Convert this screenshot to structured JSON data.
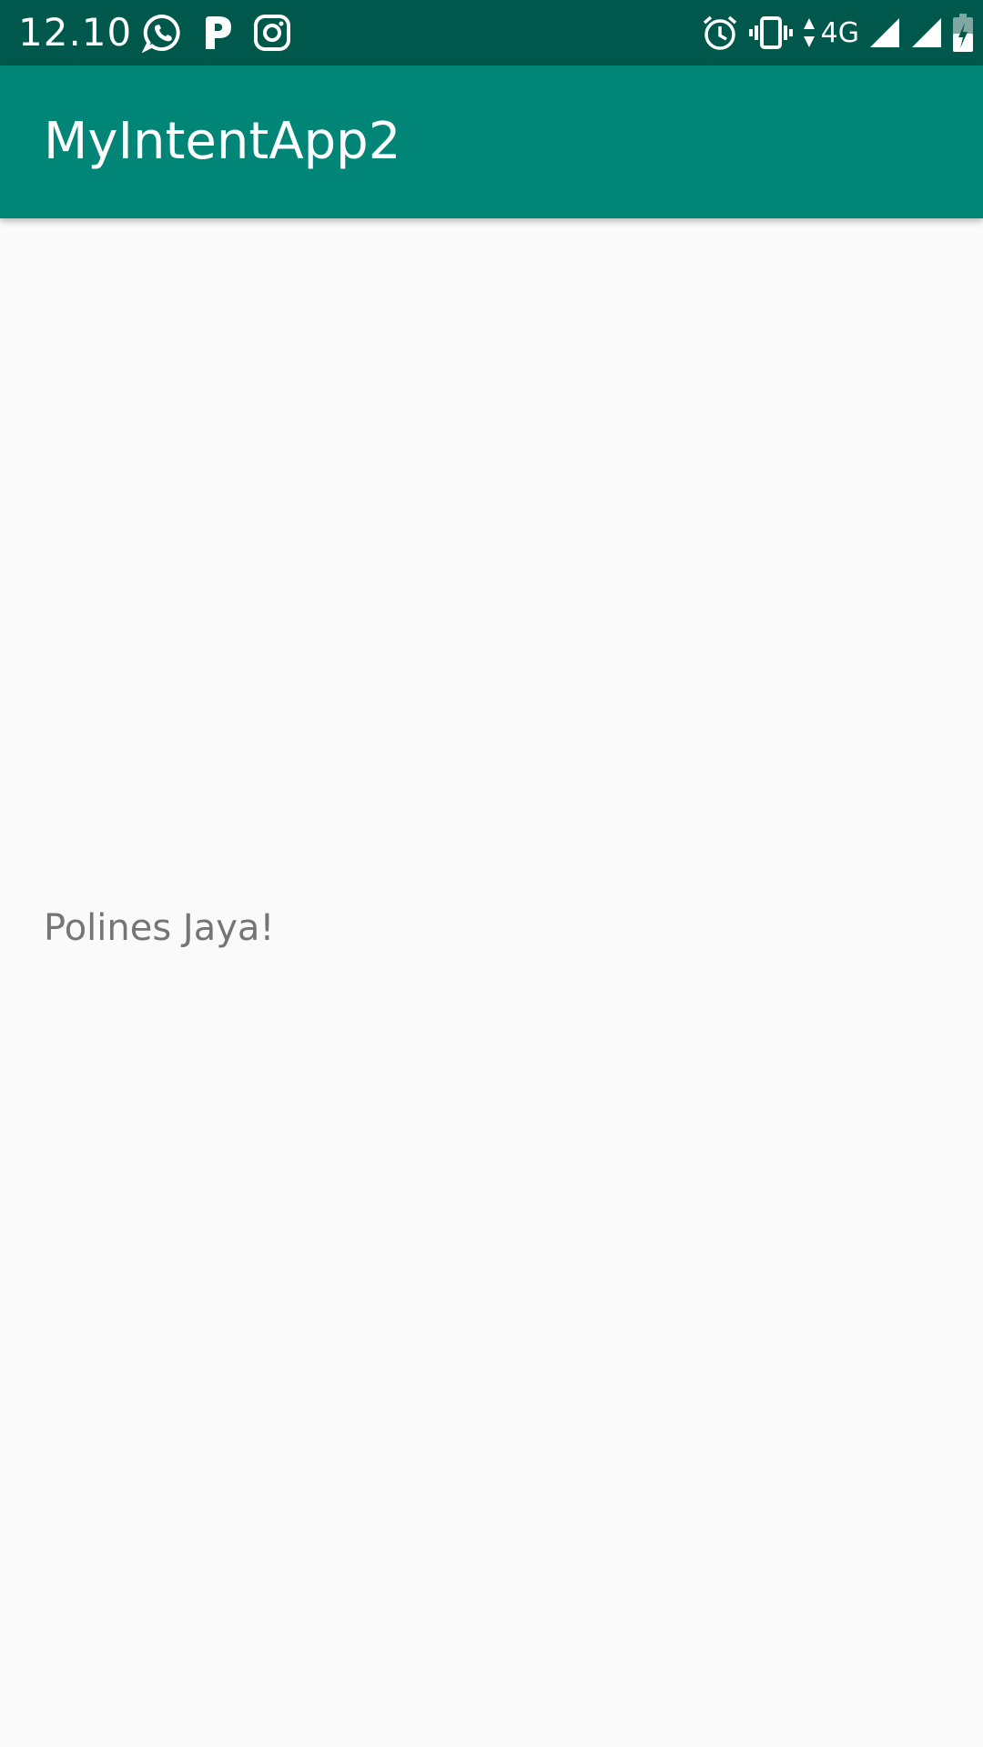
{
  "status_bar": {
    "time": "12.10",
    "network_type": "4G",
    "left_icons": [
      "whatsapp-icon",
      "parking-icon",
      "instagram-icon"
    ],
    "right_icons": [
      "alarm-icon",
      "vibrate-icon",
      "data-arrows-icon",
      "signal-icon",
      "signal-icon",
      "battery-charging-icon"
    ],
    "color": "#00574b"
  },
  "app_bar": {
    "title": "MyIntentApp2",
    "color": "#008577"
  },
  "main": {
    "text": "Polines Jaya!"
  }
}
